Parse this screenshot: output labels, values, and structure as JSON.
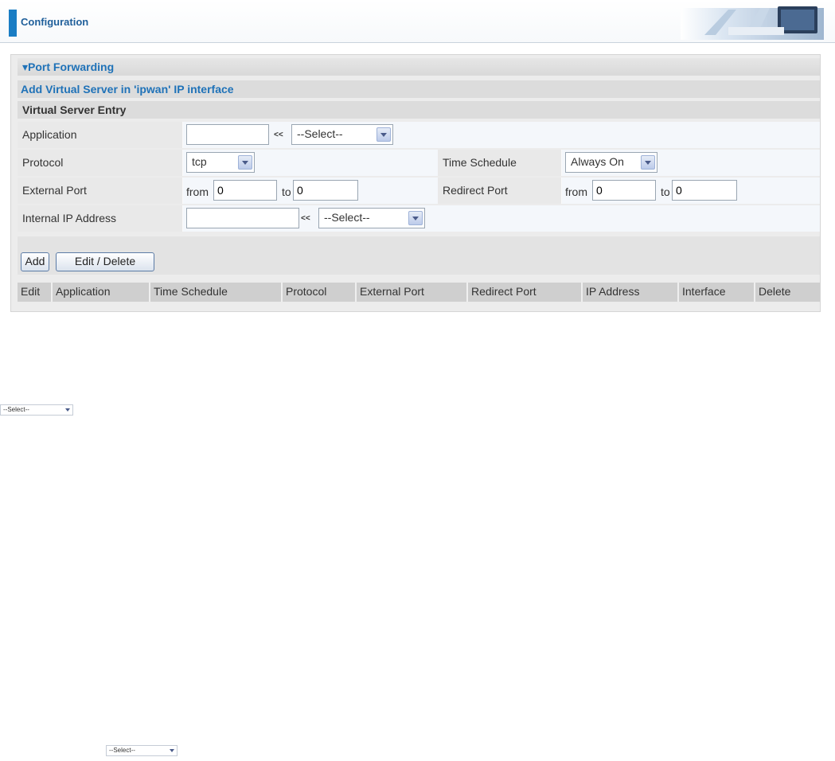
{
  "header": {
    "title": "Configuration",
    "accent_color": "#1a7dc4"
  },
  "section": {
    "title": "▾Port Forwarding",
    "subtitle": "Add Virtual Server in 'ipwan' IP interface",
    "entry_title": "Virtual Server Entry"
  },
  "form": {
    "application": {
      "label": "Application",
      "value": "",
      "separator": "<<",
      "select_value": "--Select--"
    },
    "protocol": {
      "label": "Protocol",
      "select_value": "tcp"
    },
    "time_schedule": {
      "label": "Time Schedule",
      "select_value": "Always On"
    },
    "external_port": {
      "label": "External Port",
      "from_label": "from",
      "from_value": "0",
      "to_label": "to",
      "to_value": "0"
    },
    "redirect_port": {
      "label": "Redirect Port",
      "from_label": "from",
      "from_value": "0",
      "to_label": "to",
      "to_value": "0"
    },
    "internal_ip": {
      "label": "Internal IP Address",
      "value": "",
      "separator": "<<",
      "select_value": "--Select--"
    }
  },
  "buttons": {
    "add": "Add",
    "edit_delete": "Edit / Delete"
  },
  "table": {
    "columns": [
      "Edit",
      "Application",
      "Time Schedule",
      "Protocol",
      "External Port",
      "Redirect Port",
      "IP Address",
      "Interface",
      "Delete"
    ]
  },
  "loose_selects": {
    "first": "--Select--",
    "second": "--Select--"
  }
}
